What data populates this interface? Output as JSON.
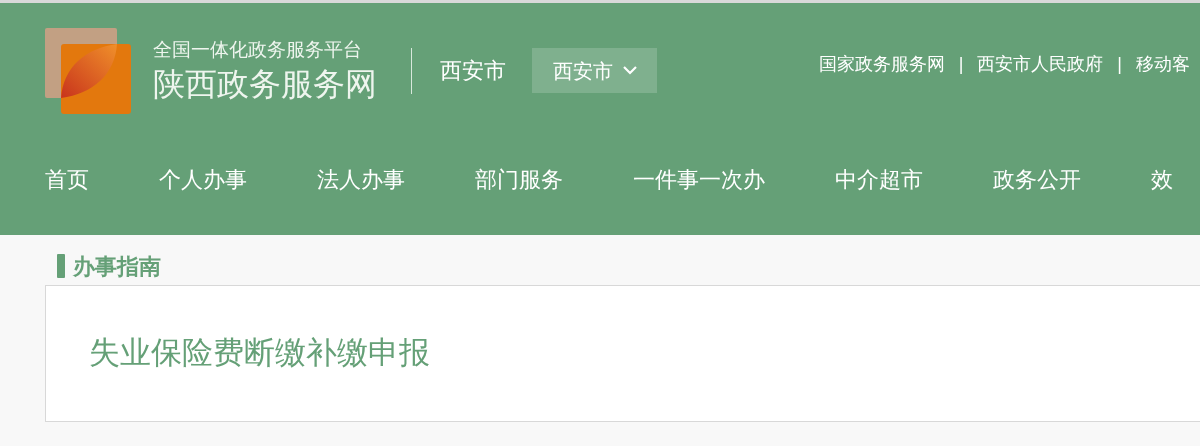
{
  "header": {
    "platform": "全国一体化政务服务平台",
    "site_name": "陕西政务服务网",
    "city": "西安市",
    "city_select": "西安市",
    "top_links": [
      "国家政务服务网",
      "西安市人民政府",
      "移动客"
    ],
    "separator": "|"
  },
  "nav": [
    {
      "label": "首页"
    },
    {
      "label": "个人办事"
    },
    {
      "label": "法人办事"
    },
    {
      "label": "部门服务"
    },
    {
      "label": "一件事一次办"
    },
    {
      "label": "中介超市"
    },
    {
      "label": "政务公开"
    },
    {
      "label": "效"
    }
  ],
  "section": {
    "title": "办事指南",
    "item_title": "失业保险费断缴补缴申报"
  }
}
